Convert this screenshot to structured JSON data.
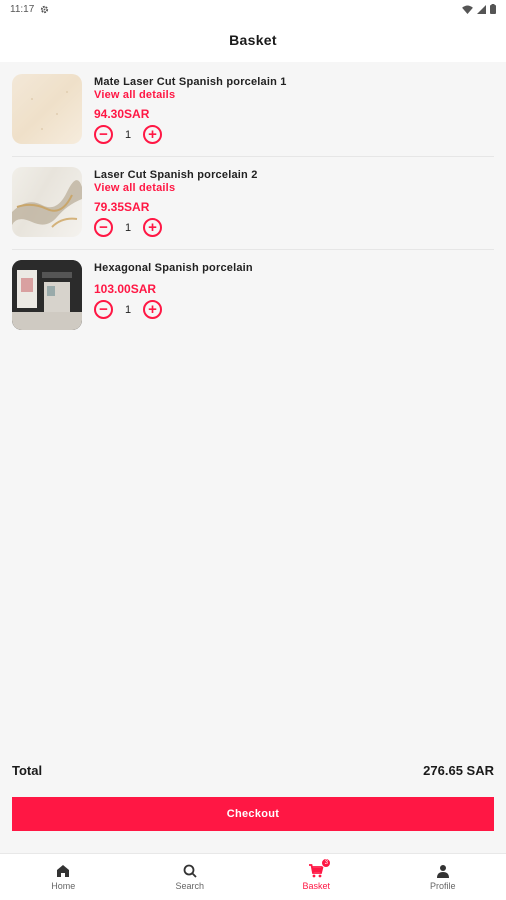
{
  "status_bar": {
    "time": "11:17"
  },
  "app_bar": {
    "title": "Basket"
  },
  "items": [
    {
      "name": "Mate Laser Cut Spanish porcelain   1",
      "details": "View all details",
      "price": "94.30SAR",
      "quantity": "1",
      "thumb": "porcelain-tile-beige"
    },
    {
      "name": "Laser Cut Spanish porcelain  2",
      "details": "View all details",
      "price": "79.35SAR",
      "quantity": "1",
      "thumb": "porcelain-tile-marble-gold"
    },
    {
      "name": "Hexagonal Spanish porcelain",
      "details": "",
      "price": "103.00SAR",
      "quantity": "1",
      "thumb": "bathroom-interior"
    }
  ],
  "summary": {
    "total_label": "Total",
    "total_value": "276.65 SAR"
  },
  "checkout": {
    "label": "Checkout"
  },
  "nav": {
    "items": [
      {
        "label": "Home",
        "icon": "home-icon"
      },
      {
        "label": "Search",
        "icon": "search-icon"
      },
      {
        "label": "Basket",
        "icon": "cart-icon",
        "badge": "3"
      },
      {
        "label": "Profile",
        "icon": "person-icon"
      }
    ],
    "active": "Basket"
  },
  "colors": {
    "accent": "#ff1744",
    "background": "#f6f6f6"
  }
}
